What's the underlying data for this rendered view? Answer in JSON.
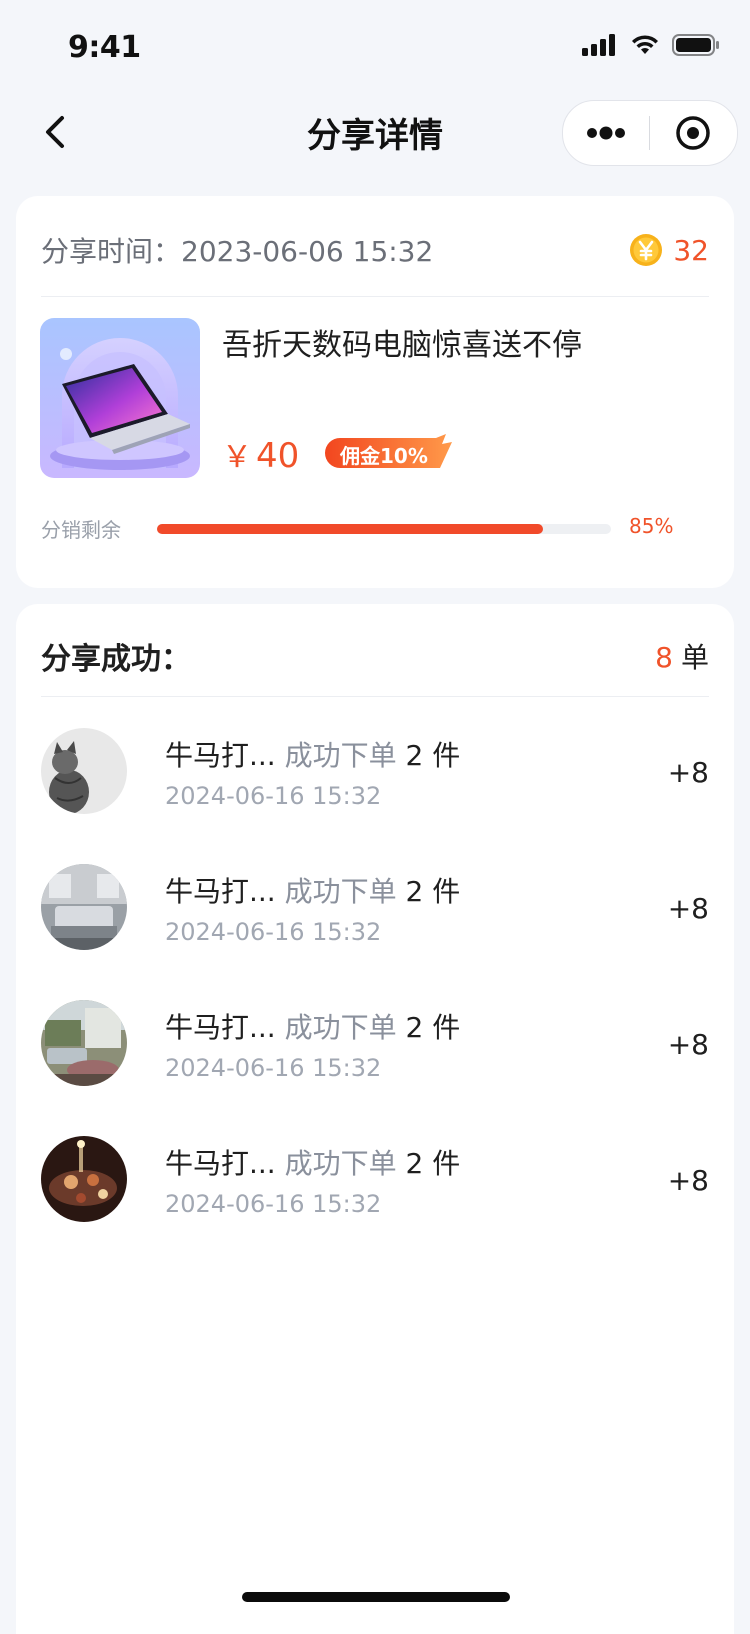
{
  "status_bar": {
    "time": "9:41"
  },
  "nav": {
    "title": "分享详情"
  },
  "share": {
    "time": "分享时间：2023-06-06 15:32",
    "coin_value": "32",
    "product_title": "吾折天数码电脑惊喜送不停",
    "price_symbol": "￥",
    "price": "40",
    "commission": "佣金10%",
    "remain_label": "分销剩余",
    "remain_percent": "85%",
    "remain_fraction": 0.85
  },
  "success": {
    "title": "分享成功：",
    "count": "8",
    "count_unit": "单",
    "items": [
      {
        "name": "牛马打...",
        "action": "成功下单",
        "qty": "2 件",
        "time": "2024-06-16 15:32",
        "reward": "+8"
      },
      {
        "name": "牛马打...",
        "action": "成功下单",
        "qty": "2 件",
        "time": "2024-06-16 15:32",
        "reward": "+8"
      },
      {
        "name": "牛马打...",
        "action": "成功下单",
        "qty": "2 件",
        "time": "2024-06-16 15:32",
        "reward": "+8"
      },
      {
        "name": "牛马打...",
        "action": "成功下单",
        "qty": "2 件",
        "time": "2024-06-16 15:32",
        "reward": "+8"
      }
    ]
  },
  "colors": {
    "accent": "#f0532a",
    "background": "#f4f6fa",
    "card": "#ffffff"
  }
}
